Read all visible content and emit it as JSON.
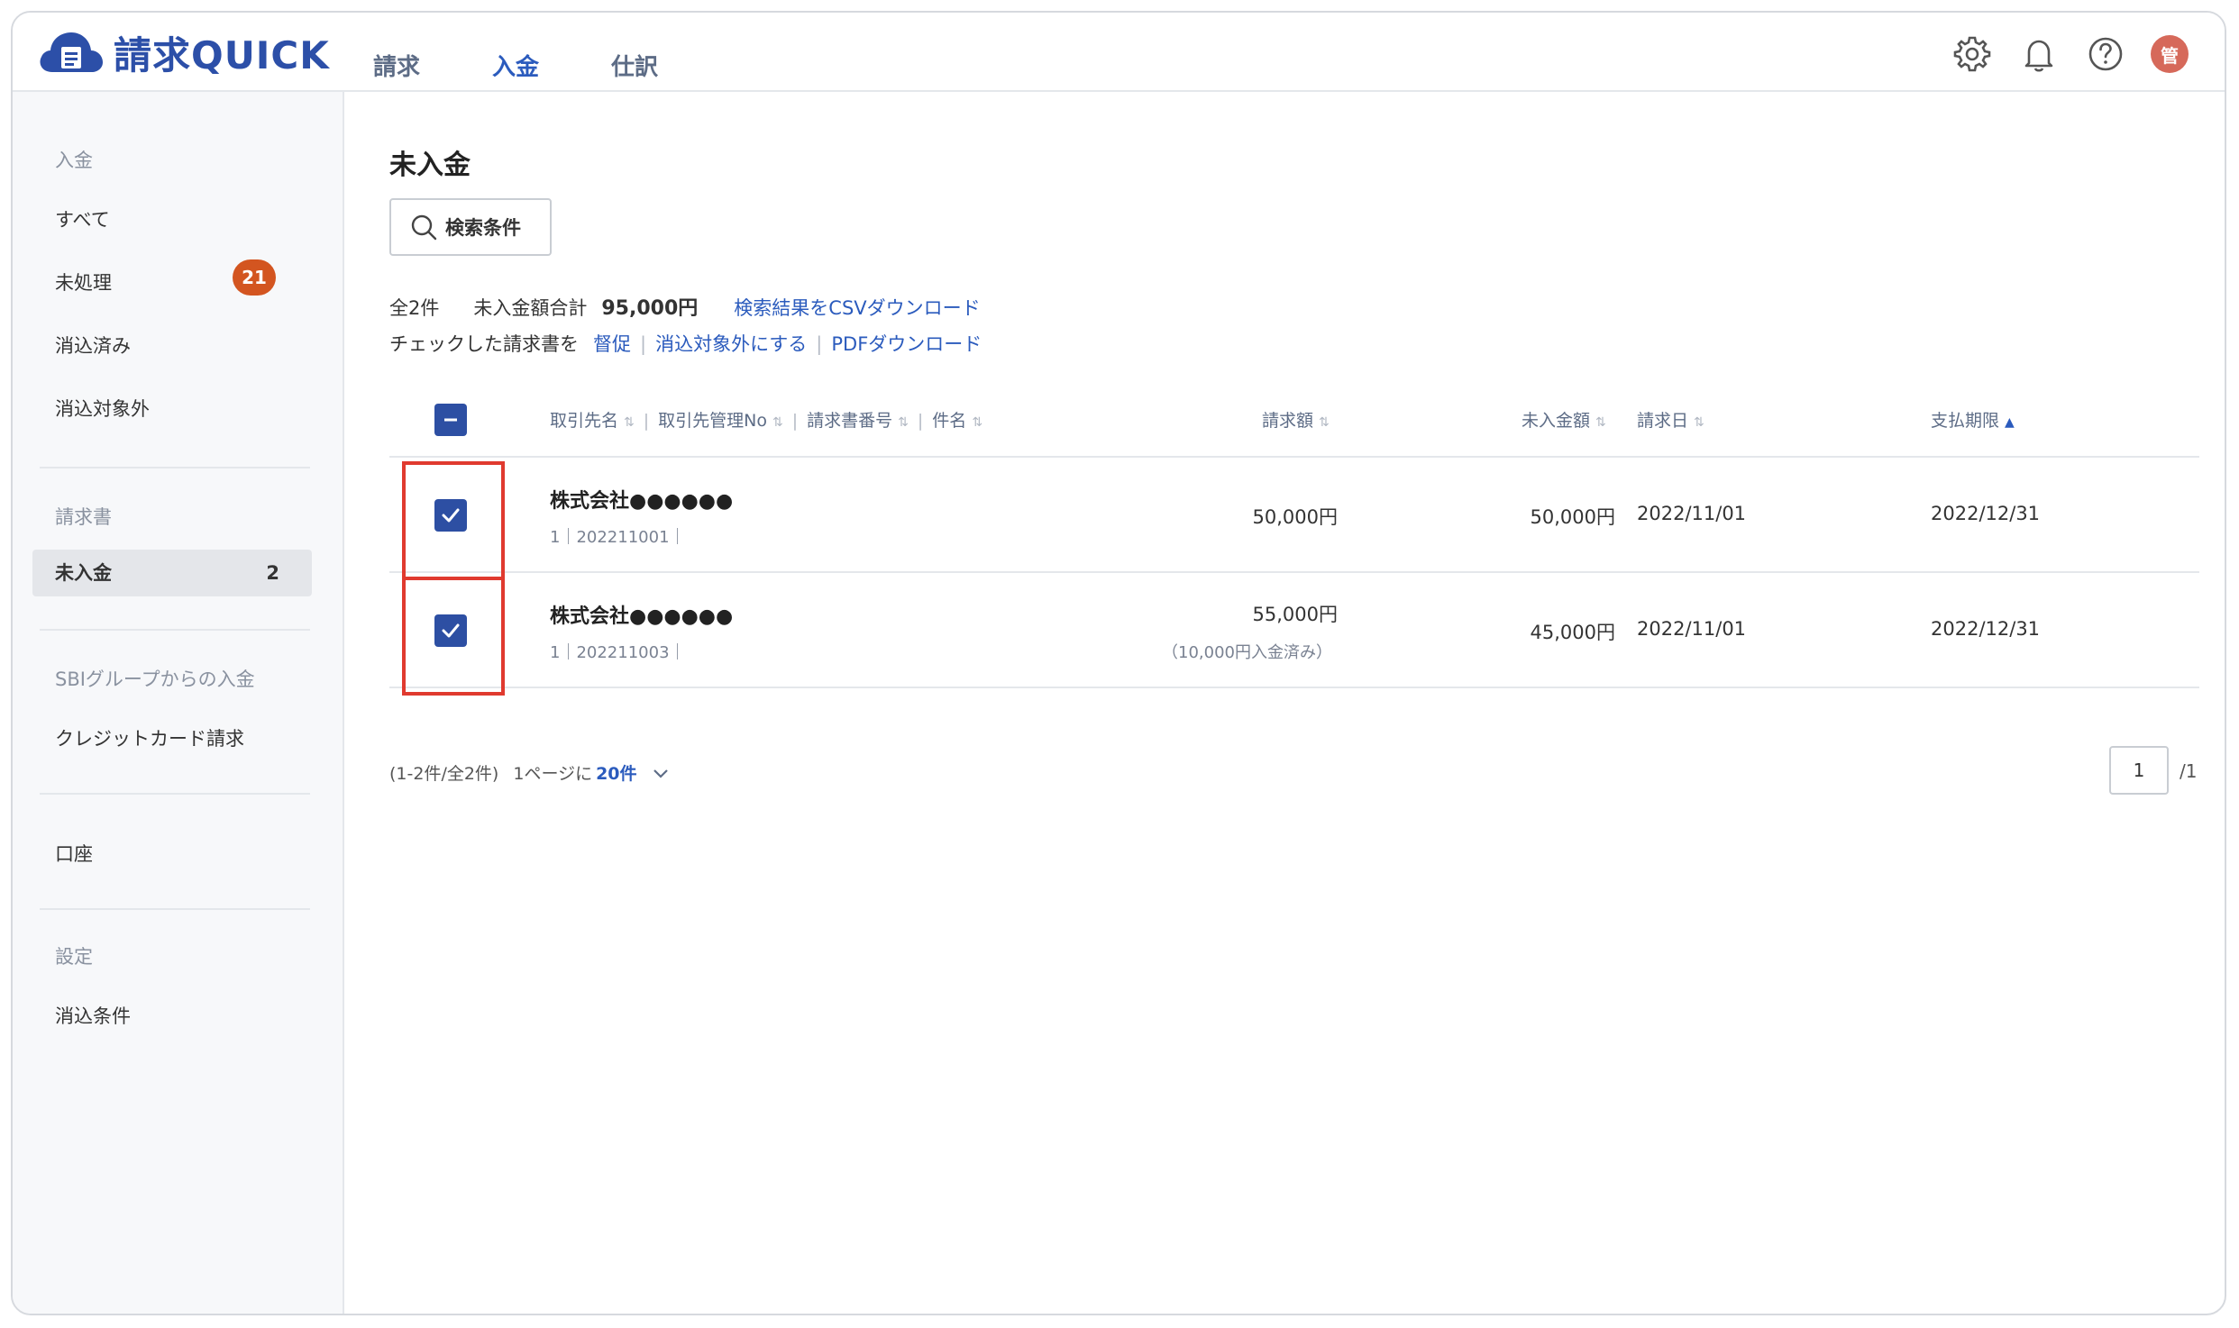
{
  "app": {
    "name": "請求QUICK"
  },
  "nav": {
    "items": [
      "請求",
      "入金",
      "仕訳"
    ],
    "active": "入金"
  },
  "header": {
    "avatar_text": "管"
  },
  "sidebar": {
    "group1": "入金",
    "all": "すべて",
    "unprocessed": "未処理",
    "unprocessed_count": "21",
    "reconciled": "消込済み",
    "excluded": "消込対象外",
    "group2": "請求書",
    "unpaid": "未入金",
    "unpaid_count": "2",
    "group3": "SBIグループからの入金",
    "credit": "クレジットカード請求",
    "account": "口座",
    "group4": "設定",
    "recon_settings": "消込条件"
  },
  "main": {
    "title": "未入金",
    "search_button": "検索条件",
    "summary": {
      "total_count": "全2件",
      "unpaid_total_label": "未入金額合計",
      "unpaid_total": "95,000円",
      "csv_link": "検索結果をCSVダウンロード"
    },
    "actions": {
      "prefix": "チェックした請求書を",
      "remind": "督促",
      "exclude": "消込対象外にする",
      "pdf": "PDFダウンロード"
    },
    "columns": {
      "client": "取引先名",
      "client_no": "取引先管理No",
      "invoice_no": "請求書番号",
      "subject": "件名",
      "amount": "請求額",
      "unpaid": "未入金額",
      "invoice_date": "請求日",
      "due_date": "支払期限"
    },
    "rows": [
      {
        "client": "株式会社●●●●●●",
        "sub": "1｜202211001｜",
        "amount": "50,000円",
        "note": "",
        "unpaid": "50,000円",
        "invoice_date": "2022/11/01",
        "due_date": "2022/12/31"
      },
      {
        "client": "株式会社●●●●●●",
        "sub": "1｜202211003｜",
        "amount": "55,000円",
        "note": "（10,000円入金済み）",
        "unpaid": "45,000円",
        "invoice_date": "2022/11/01",
        "due_date": "2022/12/31"
      }
    ],
    "pager": {
      "range": "(1-2件/全2件)",
      "per_page_label": "1ページに",
      "per_page_value": "20件",
      "current_page": "1",
      "total_pages": "/1"
    }
  },
  "colors": {
    "accent": "#2b5bbd",
    "checkbox": "#2d4fa3",
    "badge": "#d35520",
    "highlight": "#e03a2f"
  }
}
